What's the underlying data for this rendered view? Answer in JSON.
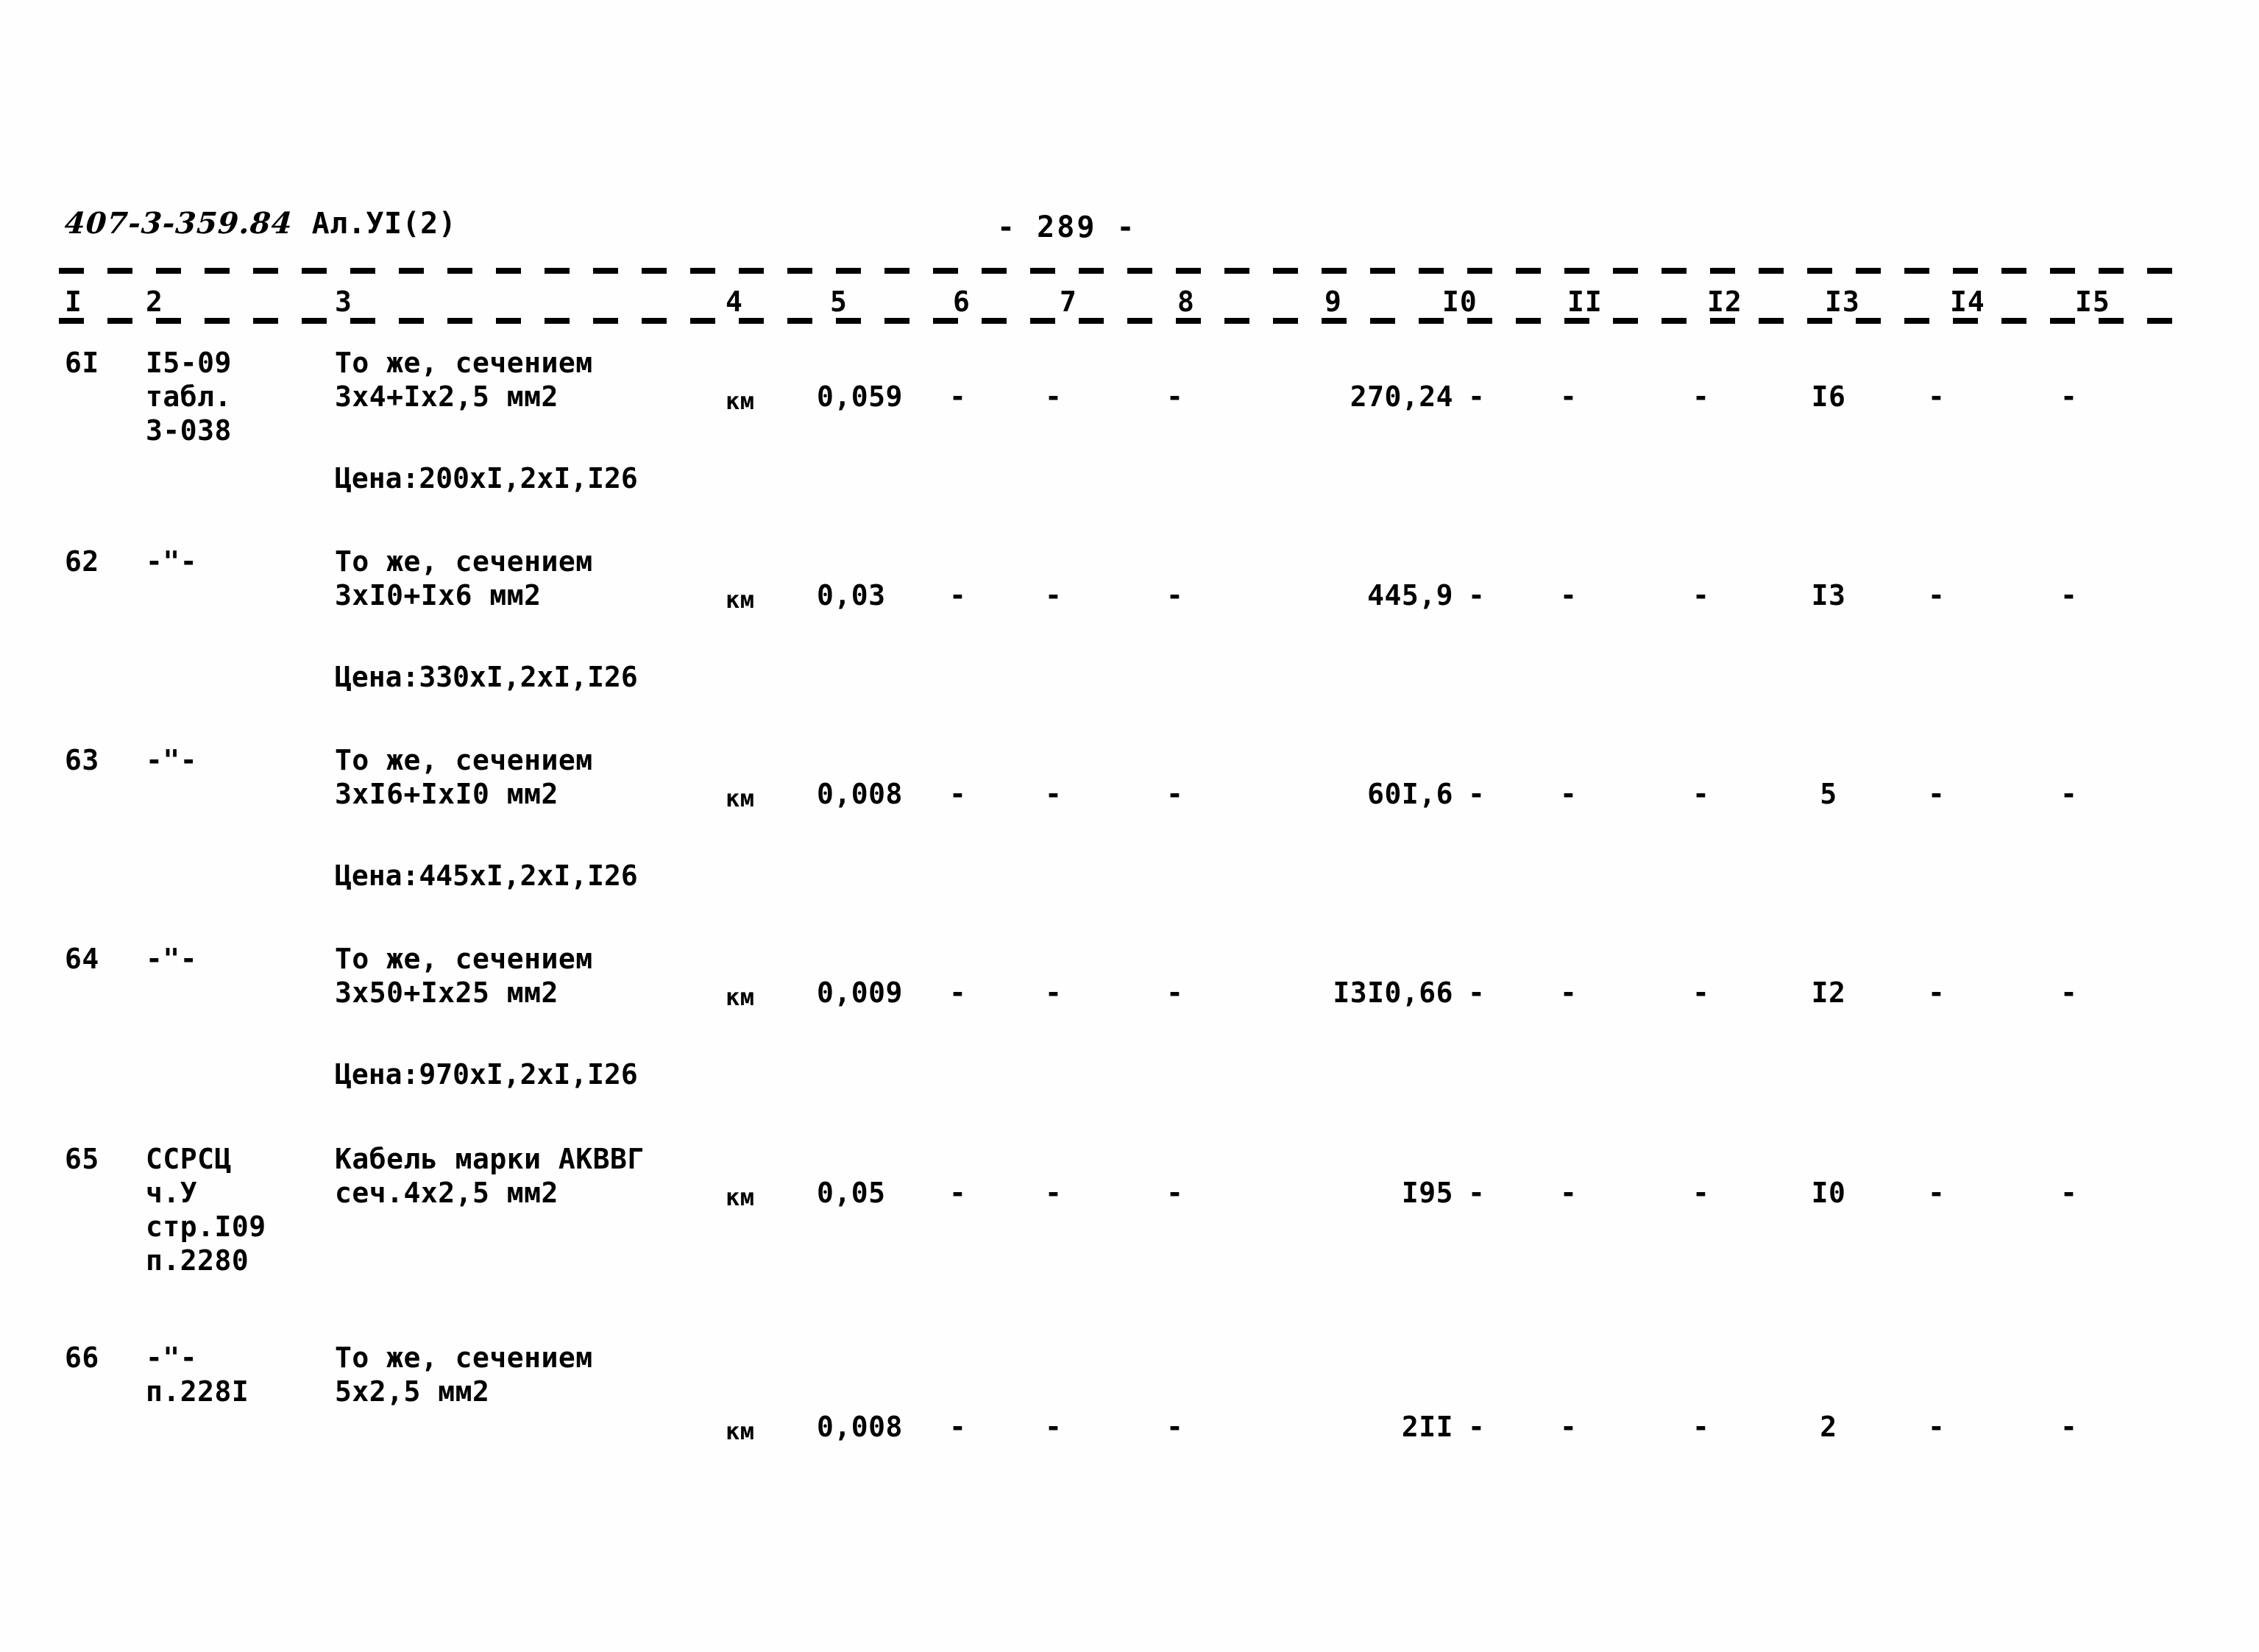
{
  "header": {
    "doc_code": "407-3-359.84",
    "album": "Ал.УI(2)",
    "page_number": "- 289 -"
  },
  "table": {
    "column_headers": [
      "I",
      "2",
      "3",
      "4",
      "5",
      "6",
      "7",
      "8",
      "9",
      "I0",
      "II",
      "I2",
      "I3",
      "I4",
      "I5"
    ],
    "rows": [
      {
        "c1": "6I",
        "c2_lines": [
          "I5-09",
          "табл.",
          "3-038"
        ],
        "c3_lines": [
          "То же, сечением",
          "3х4+Iх2,5 мм2"
        ],
        "c3_price": "Цена:200хI,2хI,I26",
        "c4": "км",
        "c5": "0,059",
        "c6": "-",
        "c7": "-",
        "c8": "-",
        "c9": "270,24",
        "c10": "-",
        "c11": "-",
        "c12": "-",
        "c13": "I6",
        "c14": "-",
        "c15": "-"
      },
      {
        "c1": "62",
        "c2_lines": [
          "-\"-"
        ],
        "c3_lines": [
          "То же, сечением",
          "3хI0+Iх6 мм2"
        ],
        "c3_price": "Цена:330хI,2хI,I26",
        "c4": "км",
        "c5": "0,03",
        "c6": "-",
        "c7": "-",
        "c8": "-",
        "c9": "445,9",
        "c10": "-",
        "c11": "-",
        "c12": "-",
        "c13": "I3",
        "c14": "-",
        "c15": "-"
      },
      {
        "c1": "63",
        "c2_lines": [
          "-\"-"
        ],
        "c3_lines": [
          "То же, сечением",
          "3хI6+IхI0 мм2"
        ],
        "c3_price": "Цена:445хI,2хI,I26",
        "c4": "км",
        "c5": "0,008",
        "c6": "-",
        "c7": "-",
        "c8": "-",
        "c9": "60I,6",
        "c10": "-",
        "c11": "-",
        "c12": "-",
        "c13": "5",
        "c14": "-",
        "c15": "-"
      },
      {
        "c1": "64",
        "c2_lines": [
          "-\"-"
        ],
        "c3_lines": [
          "То же, сечением",
          "3х50+Iх25 мм2"
        ],
        "c3_price": "Цена:970хI,2хI,I26",
        "c4": "км",
        "c5": "0,009",
        "c6": "-",
        "c7": "-",
        "c8": "-",
        "c9": "I3I0,66",
        "c10": "-",
        "c11": "-",
        "c12": "-",
        "c13": "I2",
        "c14": "-",
        "c15": "-"
      },
      {
        "c1": "65",
        "c2_lines": [
          "ССРСЦ",
          "ч.У",
          "стр.I09",
          "п.2280"
        ],
        "c3_lines": [
          "Кабель марки АКВВГ",
          "сеч.4х2,5 мм2"
        ],
        "c3_price": "",
        "c4": "км",
        "c5": "0,05",
        "c6": "-",
        "c7": "-",
        "c8": "-",
        "c9": "I95",
        "c10": "-",
        "c11": "-",
        "c12": "-",
        "c13": "I0",
        "c14": "-",
        "c15": "-"
      },
      {
        "c1": "66",
        "c2_lines": [
          "-\"-",
          "п.228I"
        ],
        "c3_lines": [
          "То же, сечением",
          "5х2,5 мм2"
        ],
        "c3_price": "",
        "c4": "км",
        "c5": "0,008",
        "c6": "-",
        "c7": "-",
        "c8": "-",
        "c9": "2II",
        "c10": "-",
        "c11": "-",
        "c12": "-",
        "c13": "2",
        "c14": "-",
        "c15": "-"
      }
    ]
  }
}
